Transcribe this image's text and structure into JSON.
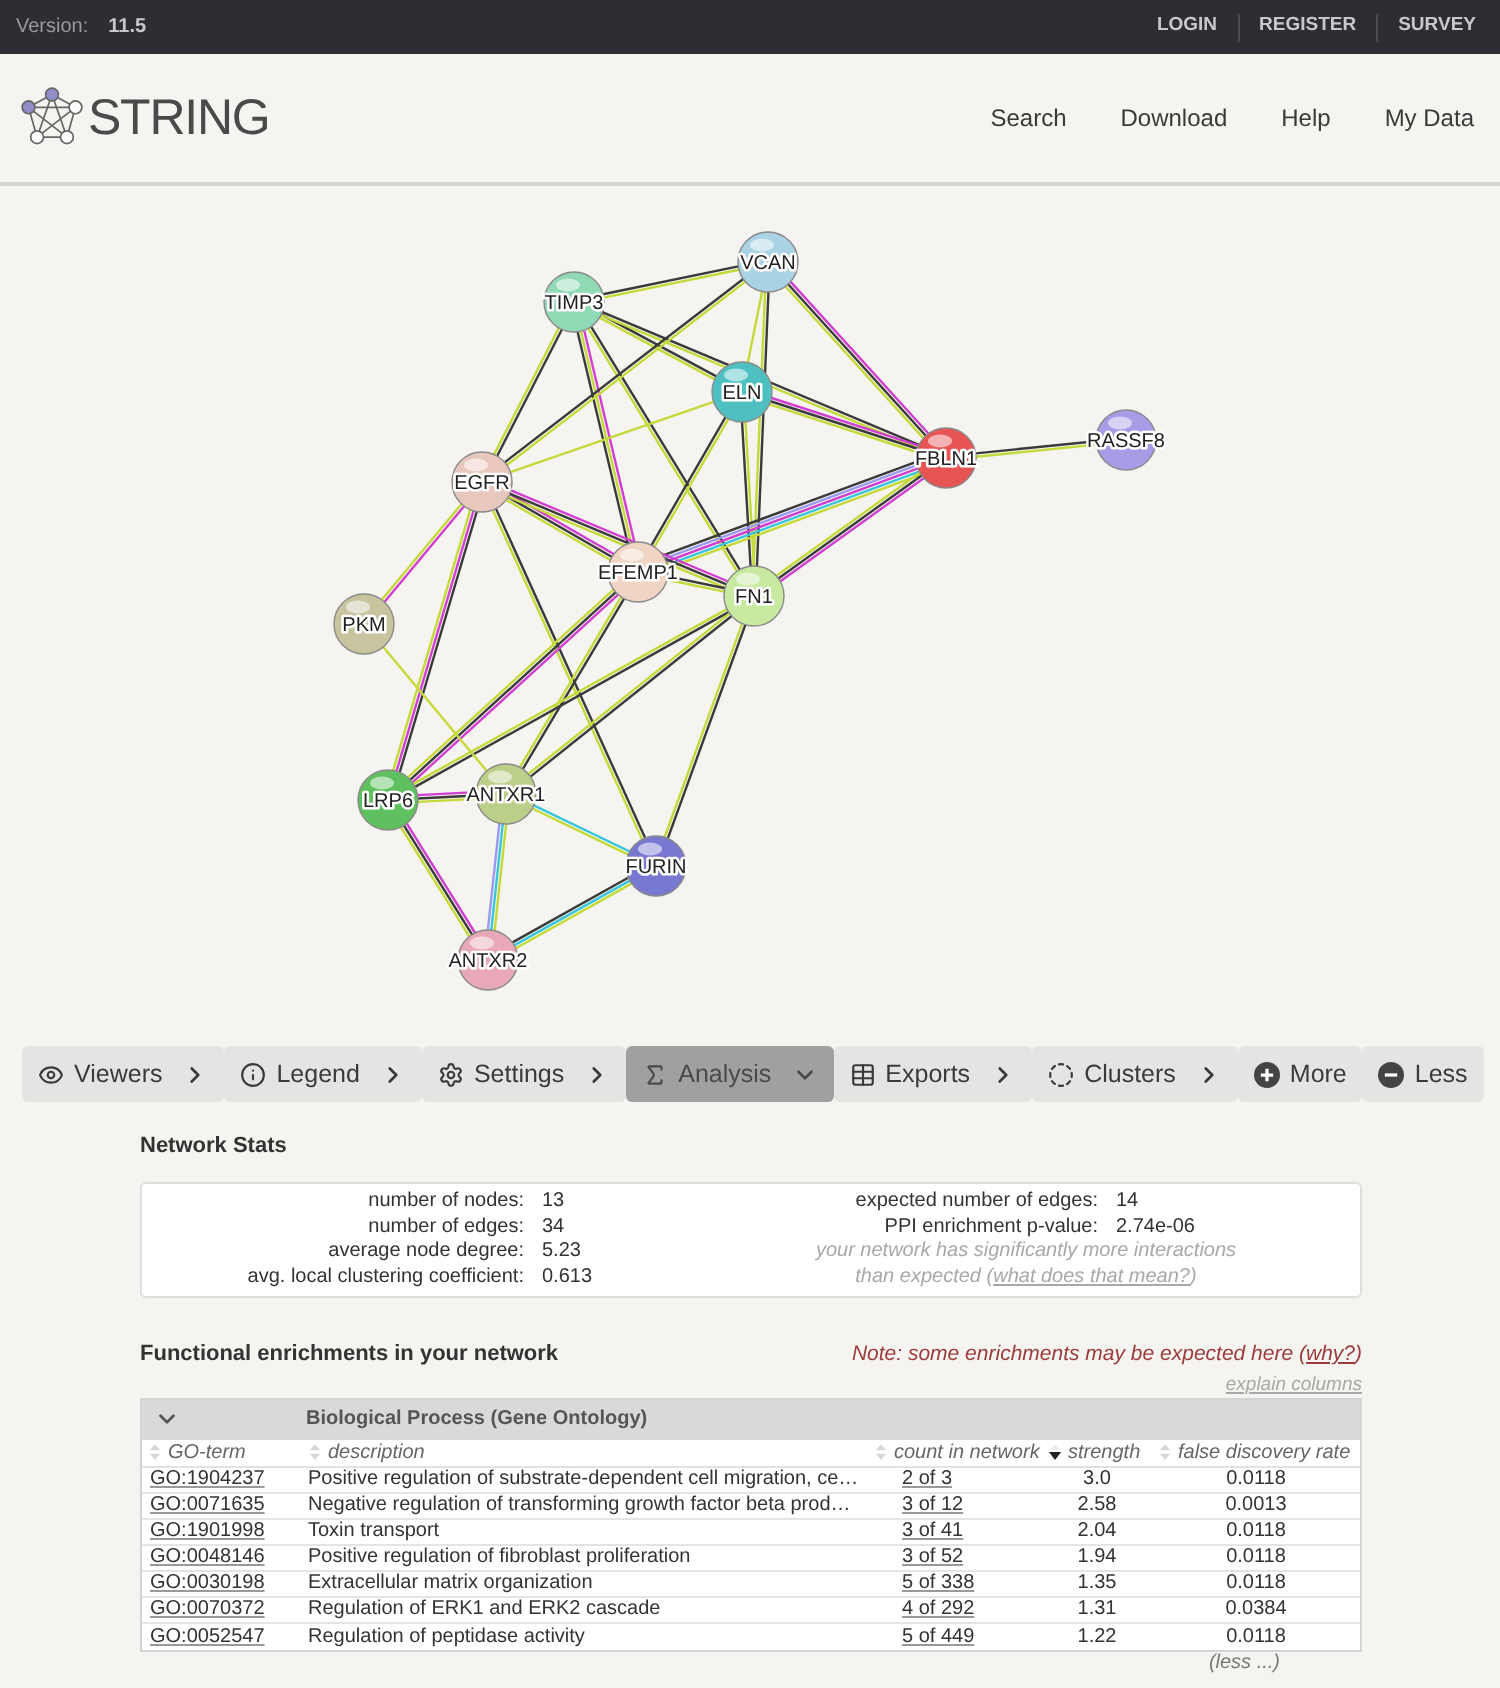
{
  "top_bar": {
    "version_label": "Version:",
    "version": "11.5",
    "links": [
      "LOGIN",
      "REGISTER",
      "SURVEY"
    ]
  },
  "header": {
    "logo_text": "STRING",
    "nav": [
      "Search",
      "Download",
      "Help",
      "My Data"
    ]
  },
  "network": {
    "nodes": [
      {
        "label": "VCAN",
        "color": "#a9d3e4"
      },
      {
        "label": "TIMP3",
        "color": "#8fdab4"
      },
      {
        "label": "ELN",
        "color": "#4ec0c2"
      },
      {
        "label": "FBLN1",
        "color": "#e65454"
      },
      {
        "label": "RASSF8",
        "color": "#a99be6"
      },
      {
        "label": "EGFR",
        "color": "#e8c8bc"
      },
      {
        "label": "EFEMP1",
        "color": "#f0d4c4"
      },
      {
        "label": "FN1",
        "color": "#c8eaa0"
      },
      {
        "label": "PKM",
        "color": "#c8c4a0"
      },
      {
        "label": "LRP6",
        "color": "#5ec05e"
      },
      {
        "label": "ANTXR1",
        "color": "#bccf88"
      },
      {
        "label": "FURIN",
        "color": "#7878d0"
      },
      {
        "label": "ANTXR2",
        "color": "#e8a8b8"
      }
    ]
  },
  "toolbar": [
    {
      "label": "Viewers",
      "kind": "menu",
      "selected": false
    },
    {
      "label": "Legend",
      "kind": "menu",
      "selected": false
    },
    {
      "label": "Settings",
      "kind": "menu",
      "selected": false
    },
    {
      "label": "Analysis",
      "kind": "menu",
      "selected": true
    },
    {
      "label": "Exports",
      "kind": "menu",
      "selected": false
    },
    {
      "label": "Clusters",
      "kind": "menu",
      "selected": false
    },
    {
      "label": "More",
      "kind": "action",
      "selected": false
    },
    {
      "label": "Less",
      "kind": "action",
      "selected": false
    }
  ],
  "network_stats": {
    "title": "Network Stats",
    "left": [
      {
        "label": "number of nodes:",
        "value": "13"
      },
      {
        "label": "number of edges:",
        "value": "34"
      },
      {
        "label": "average node degree:",
        "value": "5.23"
      },
      {
        "label": "avg. local clustering coefficient:",
        "value": "0.613"
      }
    ],
    "right": [
      {
        "label": "expected number of edges:",
        "value": "14"
      },
      {
        "label": "PPI enrichment p-value:",
        "value": "2.74e-06"
      }
    ],
    "note": {
      "text": "your network has significantly more interactions than expected (",
      "link": "what does that mean?",
      "end": ")"
    }
  },
  "enrichments": {
    "title": "Functional enrichments in your network",
    "note": {
      "text": "Note: some enrichments may be expected here (",
      "link": "why?",
      "end": ")"
    },
    "explain_link": "explain columns",
    "category": {
      "title": "Biological Process (Gene Ontology)",
      "expanded": true
    },
    "columns": [
      {
        "label": "GO-term",
        "sorted": false
      },
      {
        "label": "description",
        "sorted": false
      },
      {
        "label": "count in network",
        "sorted": false
      },
      {
        "label": "strength",
        "sorted": true
      },
      {
        "label": "false discovery rate",
        "sorted": false
      }
    ],
    "rows": [
      {
        "term": "GO:1904237",
        "description": "Positive regulation of substrate-dependent cell migration, ce…",
        "count": "2 of 3",
        "strength": "3.0",
        "fdr": "0.0118"
      },
      {
        "term": "GO:0071635",
        "description": "Negative regulation of transforming growth factor beta prod…",
        "count": "3 of 12",
        "strength": "2.58",
        "fdr": "0.0013"
      },
      {
        "term": "GO:1901998",
        "description": "Toxin transport",
        "count": "3 of 41",
        "strength": "2.04",
        "fdr": "0.0118"
      },
      {
        "term": "GO:0048146",
        "description": "Positive regulation of fibroblast proliferation",
        "count": "3 of 52",
        "strength": "1.94",
        "fdr": "0.0118"
      },
      {
        "term": "GO:0030198",
        "description": "Extracellular matrix organization",
        "count": "5 of 338",
        "strength": "1.35",
        "fdr": "0.0118"
      },
      {
        "term": "GO:0070372",
        "description": "Regulation of ERK1 and ERK2 cascade",
        "count": "4 of 292",
        "strength": "1.31",
        "fdr": "0.0384"
      },
      {
        "term": "GO:0052547",
        "description": "Regulation of peptidase activity",
        "count": "5 of 449",
        "strength": "1.22",
        "fdr": "0.0118"
      }
    ],
    "less_link": "(less ...)"
  }
}
